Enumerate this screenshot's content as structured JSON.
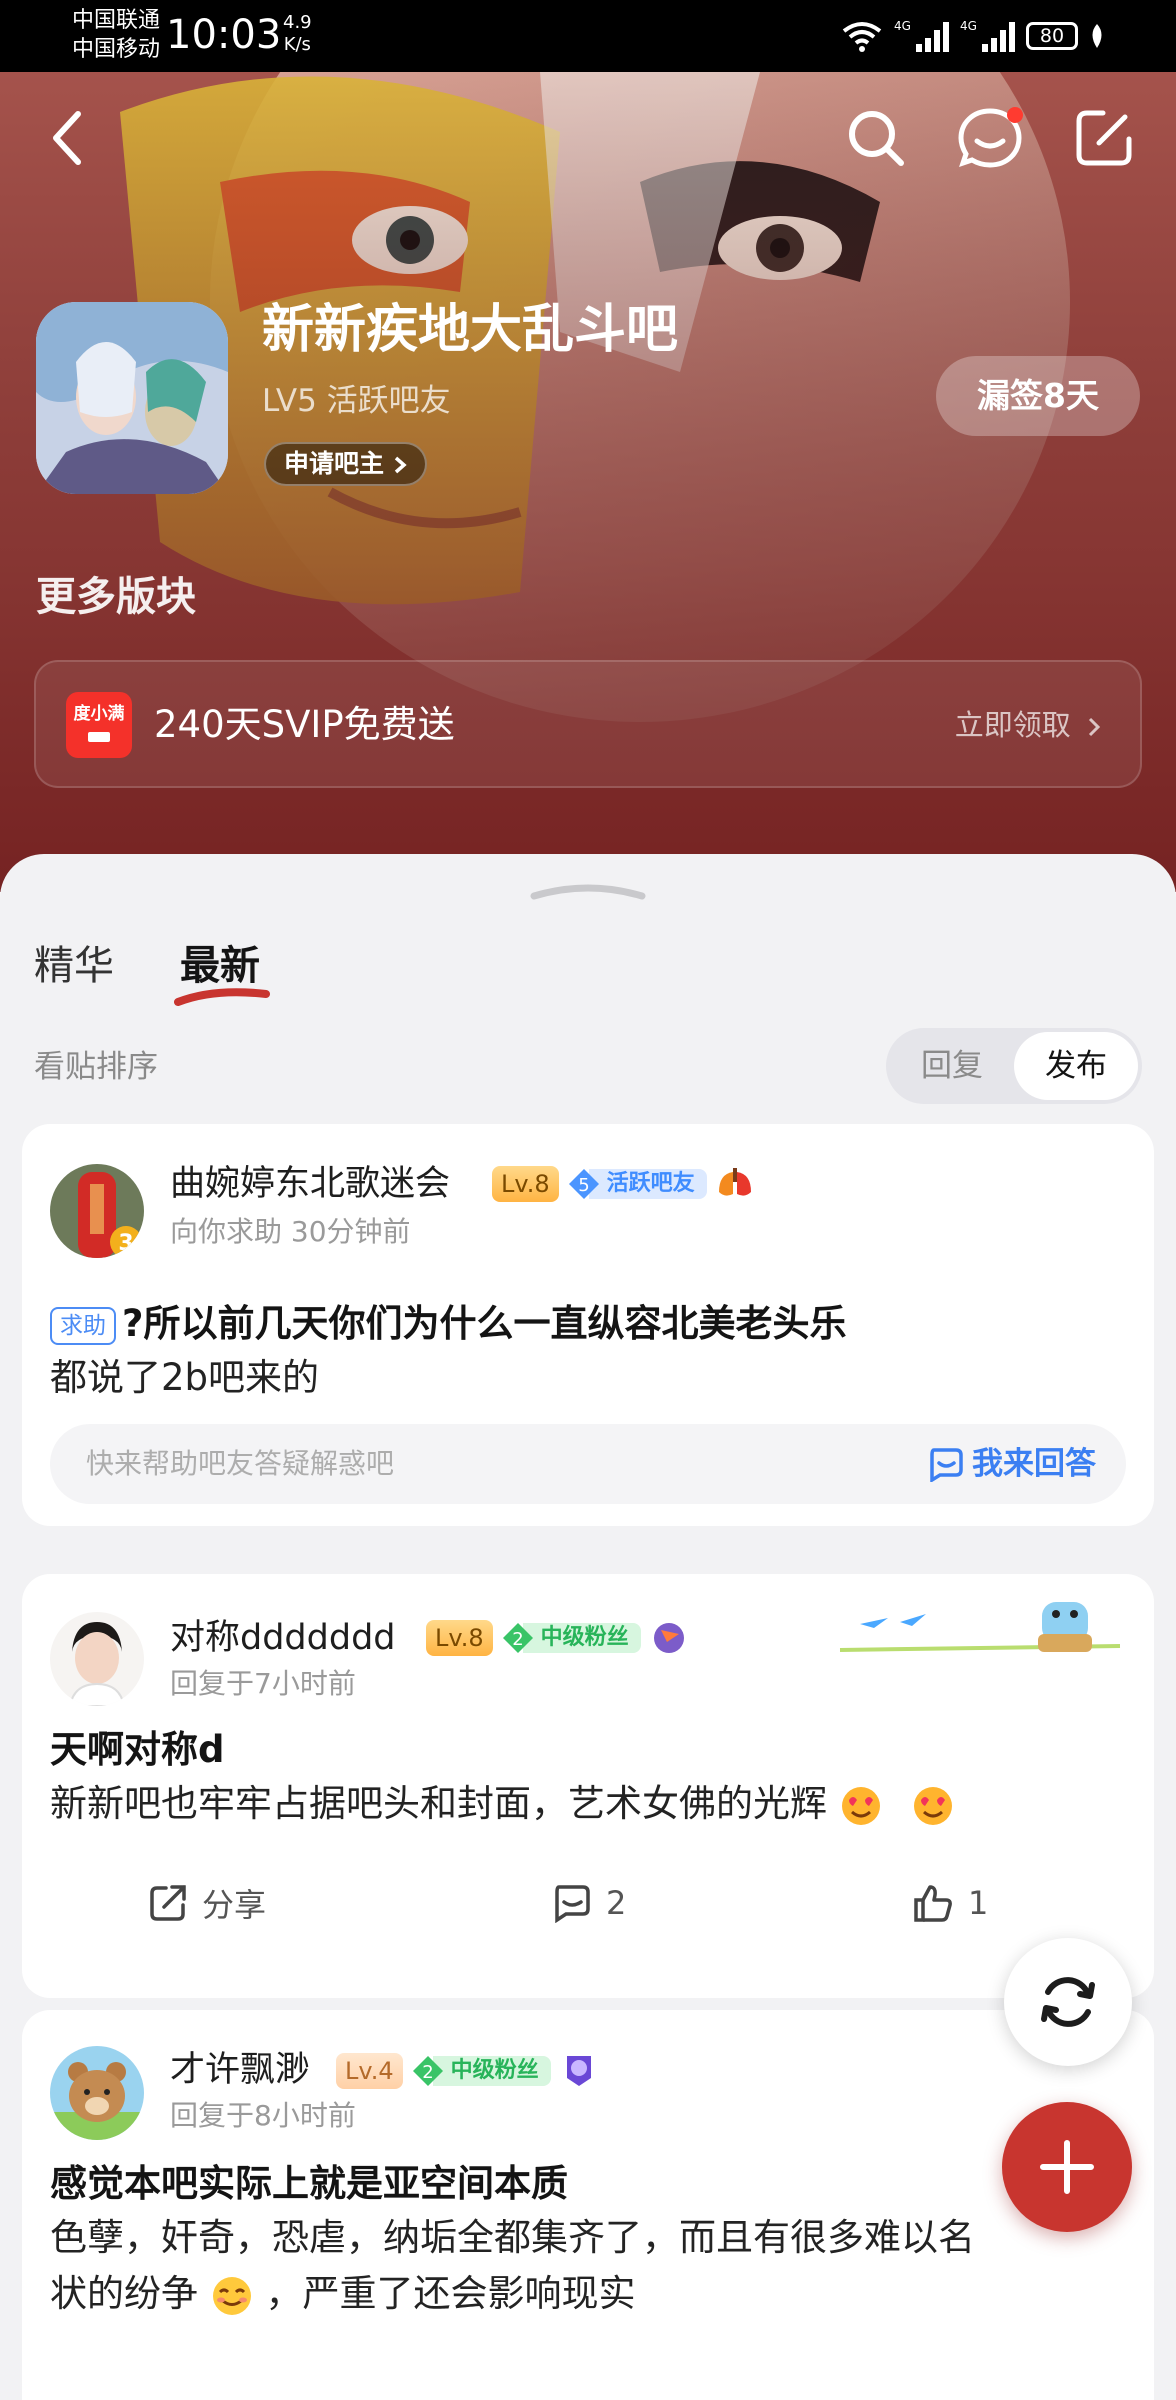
{
  "status_bar": {
    "carrier_1": "中国联通",
    "carrier_2": "中国移动",
    "time": "10:03",
    "net_speed_value": "4.9",
    "net_speed_unit": "K/s",
    "signal_label_1": "4G",
    "signal_label_2": "4G",
    "battery": "80"
  },
  "header": {
    "forum_name": "新新疾地大乱斗吧",
    "user_level": "LV5 活跃吧友",
    "apply_moderator": "申请吧主",
    "sign_in": "漏签8天",
    "more_sections": "更多版块",
    "promo": {
      "logo_text": "度小满",
      "title": "240天SVIP免费送",
      "action": "立即领取"
    }
  },
  "tabs": [
    {
      "label": "精华",
      "active": false
    },
    {
      "label": "最新",
      "active": true
    }
  ],
  "sort": {
    "label": "看贴排序",
    "options": [
      "回复",
      "发布"
    ],
    "selected": "发布"
  },
  "posts": [
    {
      "username": "曲婉婷东北歌迷会",
      "level": "Lv.8",
      "fan_level": "5",
      "fan_title": "活跃吧友",
      "avatar_badge": "3",
      "meta": "向你求助   30分钟前",
      "tag": "求助",
      "title": "?所以前几天你们为什么一直纵容北美老头乐",
      "body": "都说了2b吧来的",
      "help_placeholder": "快来帮助吧友答疑解惑吧",
      "help_action": "我来回答"
    },
    {
      "username": "对称ddddddd",
      "level": "Lv.8",
      "fan_level": "2",
      "fan_title": "中级粉丝",
      "meta": "回复于7小时前",
      "title": "天啊对称d",
      "body": "新新吧也牢牢占据吧头和封面，艺术女佛的光辉",
      "share": "分享",
      "comments": "2",
      "likes": "1"
    },
    {
      "username": "才许飘渺",
      "level": "Lv.4",
      "fan_level": "2",
      "fan_title": "中级粉丝",
      "meta": "回复于8小时前",
      "title": "感觉本吧实际上就是亚空间本质",
      "body_line_1": "色孽，奸奇，恐虐，纳垢全都集齐了，而且有很多难以名",
      "body_line_2a": "状的纷争",
      "body_line_2b": "，严重了还会影响现实"
    }
  ],
  "colors": {
    "header_red": "#7d2a2a",
    "accent_red": "#c8352f",
    "link_blue": "#3b7ff2",
    "fan_green": "#28b45a",
    "fan_blue": "#3f8cff"
  },
  "icons": [
    "back-icon",
    "search-icon",
    "message-icon",
    "edit-icon",
    "refresh-icon",
    "add-icon",
    "share-icon",
    "comment-icon",
    "like-icon",
    "chevron-right-icon",
    "answer-icon"
  ]
}
